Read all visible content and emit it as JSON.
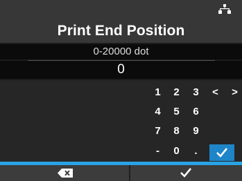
{
  "header": {
    "title": "Print End Position",
    "icon": "network-icon"
  },
  "input": {
    "range_label": "0-20000 dot",
    "value": "0"
  },
  "keypad": {
    "row1": [
      "1",
      "2",
      "3",
      "<",
      ">"
    ],
    "row2": [
      "4",
      "5",
      "6"
    ],
    "row3": [
      "7",
      "8",
      "9"
    ],
    "row4": [
      "-",
      "0",
      "."
    ],
    "confirm_icon": "check-icon"
  },
  "footer": {
    "left_icon": "backspace-icon",
    "right_icon": "check-icon",
    "accent_color": "#2aa3e6"
  }
}
